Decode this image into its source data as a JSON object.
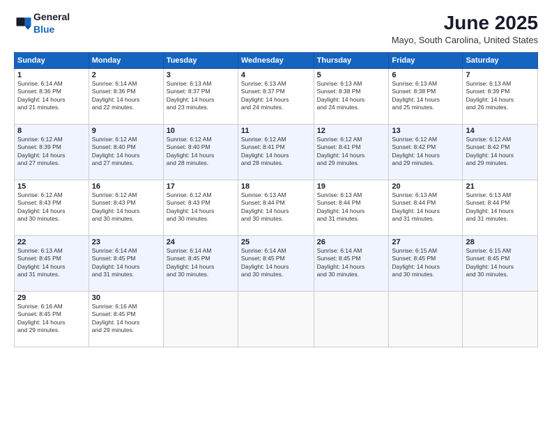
{
  "logo": {
    "general": "General",
    "blue": "Blue"
  },
  "title": "June 2025",
  "subtitle": "Mayo, South Carolina, United States",
  "headers": [
    "Sunday",
    "Monday",
    "Tuesday",
    "Wednesday",
    "Thursday",
    "Friday",
    "Saturday"
  ],
  "weeks": [
    [
      {
        "day": "1",
        "info": "Sunrise: 6:14 AM\nSunset: 8:36 PM\nDaylight: 14 hours\nand 21 minutes."
      },
      {
        "day": "2",
        "info": "Sunrise: 6:14 AM\nSunset: 8:36 PM\nDaylight: 14 hours\nand 22 minutes."
      },
      {
        "day": "3",
        "info": "Sunrise: 6:13 AM\nSunset: 8:37 PM\nDaylight: 14 hours\nand 23 minutes."
      },
      {
        "day": "4",
        "info": "Sunrise: 6:13 AM\nSunset: 8:37 PM\nDaylight: 14 hours\nand 24 minutes."
      },
      {
        "day": "5",
        "info": "Sunrise: 6:13 AM\nSunset: 8:38 PM\nDaylight: 14 hours\nand 24 minutes."
      },
      {
        "day": "6",
        "info": "Sunrise: 6:13 AM\nSunset: 8:38 PM\nDaylight: 14 hours\nand 25 minutes."
      },
      {
        "day": "7",
        "info": "Sunrise: 6:13 AM\nSunset: 8:39 PM\nDaylight: 14 hours\nand 26 minutes."
      }
    ],
    [
      {
        "day": "8",
        "info": "Sunrise: 6:12 AM\nSunset: 8:39 PM\nDaylight: 14 hours\nand 27 minutes."
      },
      {
        "day": "9",
        "info": "Sunrise: 6:12 AM\nSunset: 8:40 PM\nDaylight: 14 hours\nand 27 minutes."
      },
      {
        "day": "10",
        "info": "Sunrise: 6:12 AM\nSunset: 8:40 PM\nDaylight: 14 hours\nand 28 minutes."
      },
      {
        "day": "11",
        "info": "Sunrise: 6:12 AM\nSunset: 8:41 PM\nDaylight: 14 hours\nand 28 minutes."
      },
      {
        "day": "12",
        "info": "Sunrise: 6:12 AM\nSunset: 8:41 PM\nDaylight: 14 hours\nand 29 minutes."
      },
      {
        "day": "13",
        "info": "Sunrise: 6:12 AM\nSunset: 8:42 PM\nDaylight: 14 hours\nand 29 minutes."
      },
      {
        "day": "14",
        "info": "Sunrise: 6:12 AM\nSunset: 8:42 PM\nDaylight: 14 hours\nand 29 minutes."
      }
    ],
    [
      {
        "day": "15",
        "info": "Sunrise: 6:12 AM\nSunset: 8:43 PM\nDaylight: 14 hours\nand 30 minutes."
      },
      {
        "day": "16",
        "info": "Sunrise: 6:12 AM\nSunset: 8:43 PM\nDaylight: 14 hours\nand 30 minutes."
      },
      {
        "day": "17",
        "info": "Sunrise: 6:12 AM\nSunset: 8:43 PM\nDaylight: 14 hours\nand 30 minutes."
      },
      {
        "day": "18",
        "info": "Sunrise: 6:13 AM\nSunset: 8:44 PM\nDaylight: 14 hours\nand 30 minutes."
      },
      {
        "day": "19",
        "info": "Sunrise: 6:13 AM\nSunset: 8:44 PM\nDaylight: 14 hours\nand 31 minutes."
      },
      {
        "day": "20",
        "info": "Sunrise: 6:13 AM\nSunset: 8:44 PM\nDaylight: 14 hours\nand 31 minutes."
      },
      {
        "day": "21",
        "info": "Sunrise: 6:13 AM\nSunset: 8:44 PM\nDaylight: 14 hours\nand 31 minutes."
      }
    ],
    [
      {
        "day": "22",
        "info": "Sunrise: 6:13 AM\nSunset: 8:45 PM\nDaylight: 14 hours\nand 31 minutes."
      },
      {
        "day": "23",
        "info": "Sunrise: 6:14 AM\nSunset: 8:45 PM\nDaylight: 14 hours\nand 31 minutes."
      },
      {
        "day": "24",
        "info": "Sunrise: 6:14 AM\nSunset: 8:45 PM\nDaylight: 14 hours\nand 30 minutes."
      },
      {
        "day": "25",
        "info": "Sunrise: 6:14 AM\nSunset: 8:45 PM\nDaylight: 14 hours\nand 30 minutes."
      },
      {
        "day": "26",
        "info": "Sunrise: 6:14 AM\nSunset: 8:45 PM\nDaylight: 14 hours\nand 30 minutes."
      },
      {
        "day": "27",
        "info": "Sunrise: 6:15 AM\nSunset: 8:45 PM\nDaylight: 14 hours\nand 30 minutes."
      },
      {
        "day": "28",
        "info": "Sunrise: 6:15 AM\nSunset: 8:45 PM\nDaylight: 14 hours\nand 30 minutes."
      }
    ],
    [
      {
        "day": "29",
        "info": "Sunrise: 6:16 AM\nSunset: 8:45 PM\nDaylight: 14 hours\nand 29 minutes."
      },
      {
        "day": "30",
        "info": "Sunrise: 6:16 AM\nSunset: 8:45 PM\nDaylight: 14 hours\nand 29 minutes."
      },
      null,
      null,
      null,
      null,
      null
    ]
  ]
}
